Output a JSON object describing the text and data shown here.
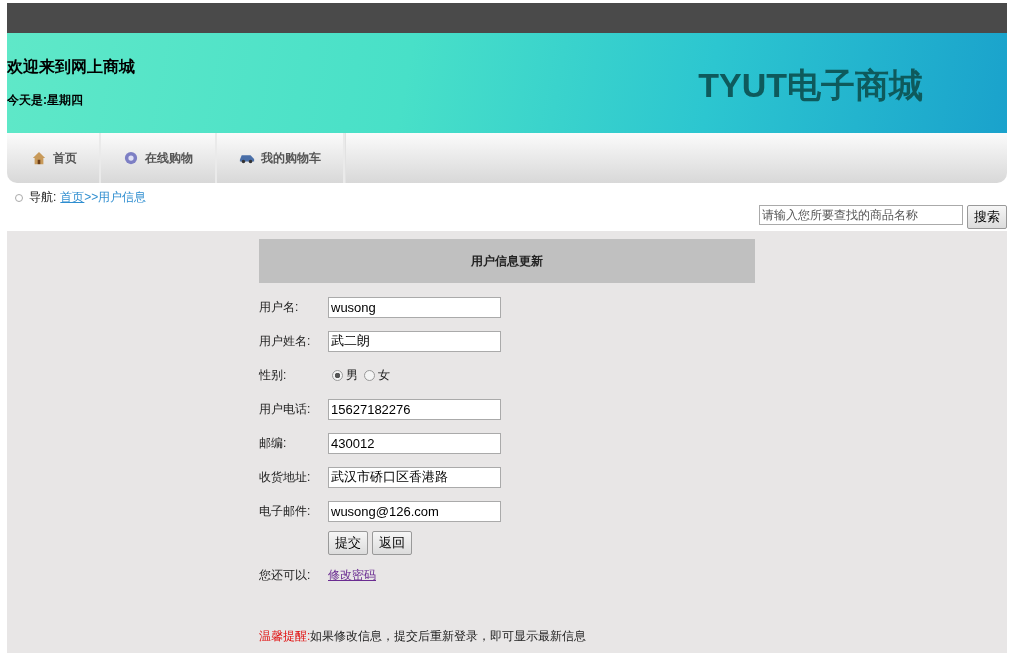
{
  "header": {
    "welcome": "欢迎来到网上商城",
    "today": "今天是:星期四",
    "logo": "TYUT电子商城"
  },
  "nav": [
    {
      "label": "首页"
    },
    {
      "label": "在线购物"
    },
    {
      "label": "我的购物车"
    }
  ],
  "breadcrumb": {
    "prefix": "导航:",
    "home": "首页",
    "current": ">>用户信息"
  },
  "search": {
    "placeholder": "请输入您所要查找的商品名称",
    "button": "搜索"
  },
  "form": {
    "title": "用户信息更新",
    "fields": [
      {
        "kind": "text",
        "label": "用户名:",
        "value": "wusong"
      },
      {
        "kind": "text",
        "label": "用户姓名:",
        "value": "武二朗"
      },
      {
        "kind": "radio",
        "label": "性别:",
        "options": [
          {
            "label": "男",
            "selected": true
          },
          {
            "label": "女",
            "selected": false
          }
        ]
      },
      {
        "kind": "text",
        "label": "用户电话:",
        "value": "15627182276"
      },
      {
        "kind": "text",
        "label": "邮编:",
        "value": "430012"
      },
      {
        "kind": "text",
        "label": "收货地址:",
        "value": "武汉市硚口区香港路"
      },
      {
        "kind": "text",
        "label": "电子邮件:",
        "value": "wusong@126.com"
      }
    ],
    "buttons": [
      "提交",
      "返回"
    ],
    "extra_label": "您还可以:",
    "extra_link": "修改密码"
  },
  "tip": {
    "label": "温馨提醒:",
    "text": "如果修改信息，提交后重新登录，即可显示最新信息"
  }
}
